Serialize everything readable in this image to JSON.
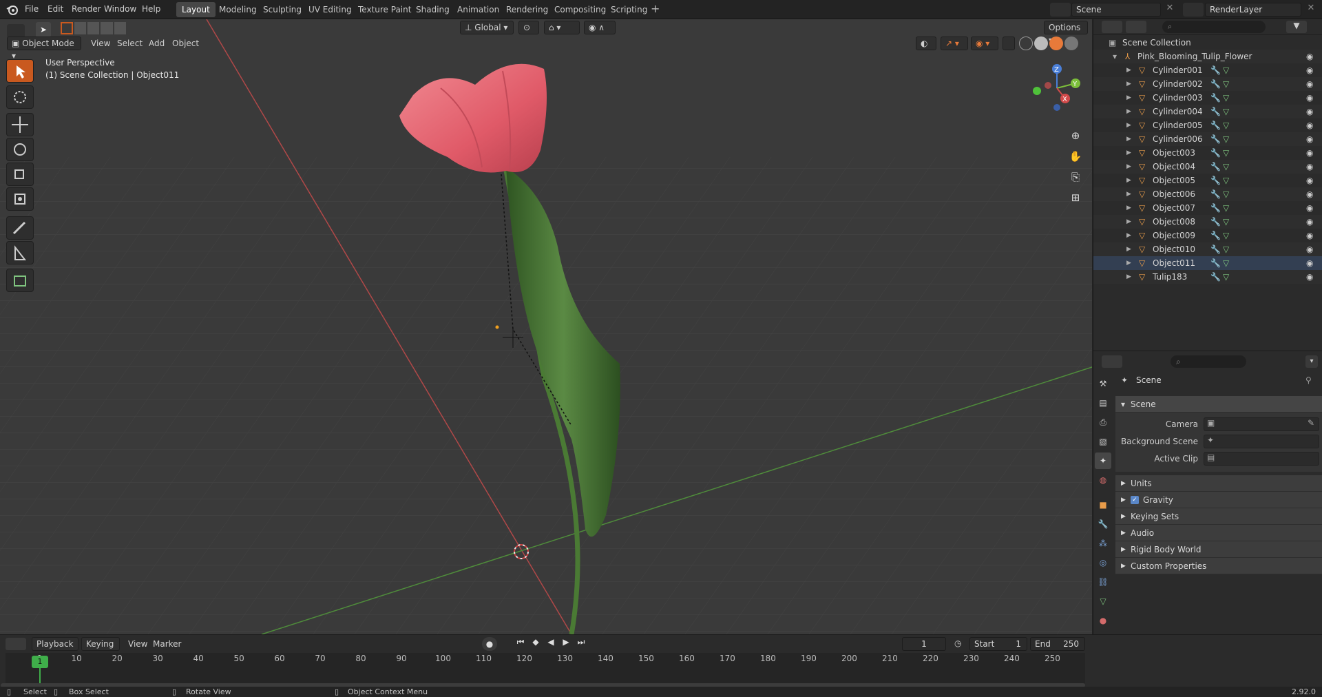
{
  "menu": {
    "file": "File",
    "edit": "Edit",
    "render": "Render",
    "window": "Window",
    "help": "Help"
  },
  "workspace_tabs": [
    "Layout",
    "Modeling",
    "Sculpting",
    "UV Editing",
    "Texture Paint",
    "Shading",
    "Animation",
    "Rendering",
    "Compositing",
    "Scripting"
  ],
  "active_tab": "Layout",
  "scene_field": "Scene",
  "view_layer_field": "RenderLayer",
  "header": {
    "transform_orientation": "Global",
    "options": "Options"
  },
  "viewport_header": {
    "mode": "Object Mode",
    "view": "View",
    "select": "Select",
    "add": "Add",
    "object": "Object"
  },
  "viewport_overlay": {
    "perspective": "User Perspective",
    "context": "(1) Scene Collection | Object011"
  },
  "gizmo": {
    "x": "X",
    "y": "Y",
    "z": "Z"
  },
  "outliner": {
    "root": "Scene Collection",
    "parent": "Pink_Blooming_Tulip_Flower",
    "items": [
      "Cylinder001",
      "Cylinder002",
      "Cylinder003",
      "Cylinder004",
      "Cylinder005",
      "Cylinder006",
      "Object003",
      "Object004",
      "Object005",
      "Object006",
      "Object007",
      "Object008",
      "Object009",
      "Object010",
      "Object011",
      "Tulip183"
    ],
    "selected": "Object011"
  },
  "properties": {
    "title": "Scene",
    "panel_open": "Scene",
    "camera_label": "Camera",
    "background_label": "Background Scene",
    "clip_label": "Active Clip",
    "panels": [
      "Units",
      "Gravity",
      "Keying Sets",
      "Audio",
      "Rigid Body World",
      "Custom Properties"
    ]
  },
  "timeline": {
    "playback": "Playback",
    "keying": "Keying",
    "view": "View",
    "marker": "Marker",
    "current_frame": "1",
    "start_label": "Start",
    "start": "1",
    "end_label": "End",
    "end": "250",
    "ticks": [
      "1",
      "10",
      "20",
      "30",
      "40",
      "50",
      "60",
      "70",
      "80",
      "90",
      "100",
      "110",
      "120",
      "130",
      "140",
      "150",
      "160",
      "170",
      "180",
      "190",
      "200",
      "210",
      "220",
      "230",
      "240",
      "250"
    ]
  },
  "status": {
    "select": "Select",
    "box_select": "Box Select",
    "rotate": "Rotate View",
    "context_menu": "Object Context Menu",
    "version": "2.92.0"
  },
  "colors": {
    "accent": "#c9591f",
    "selection": "#333f52",
    "x_axis": "#c24848",
    "y_axis": "#5a9a3e",
    "tulip": "#e05a68",
    "stem": "#3f6e2c"
  }
}
